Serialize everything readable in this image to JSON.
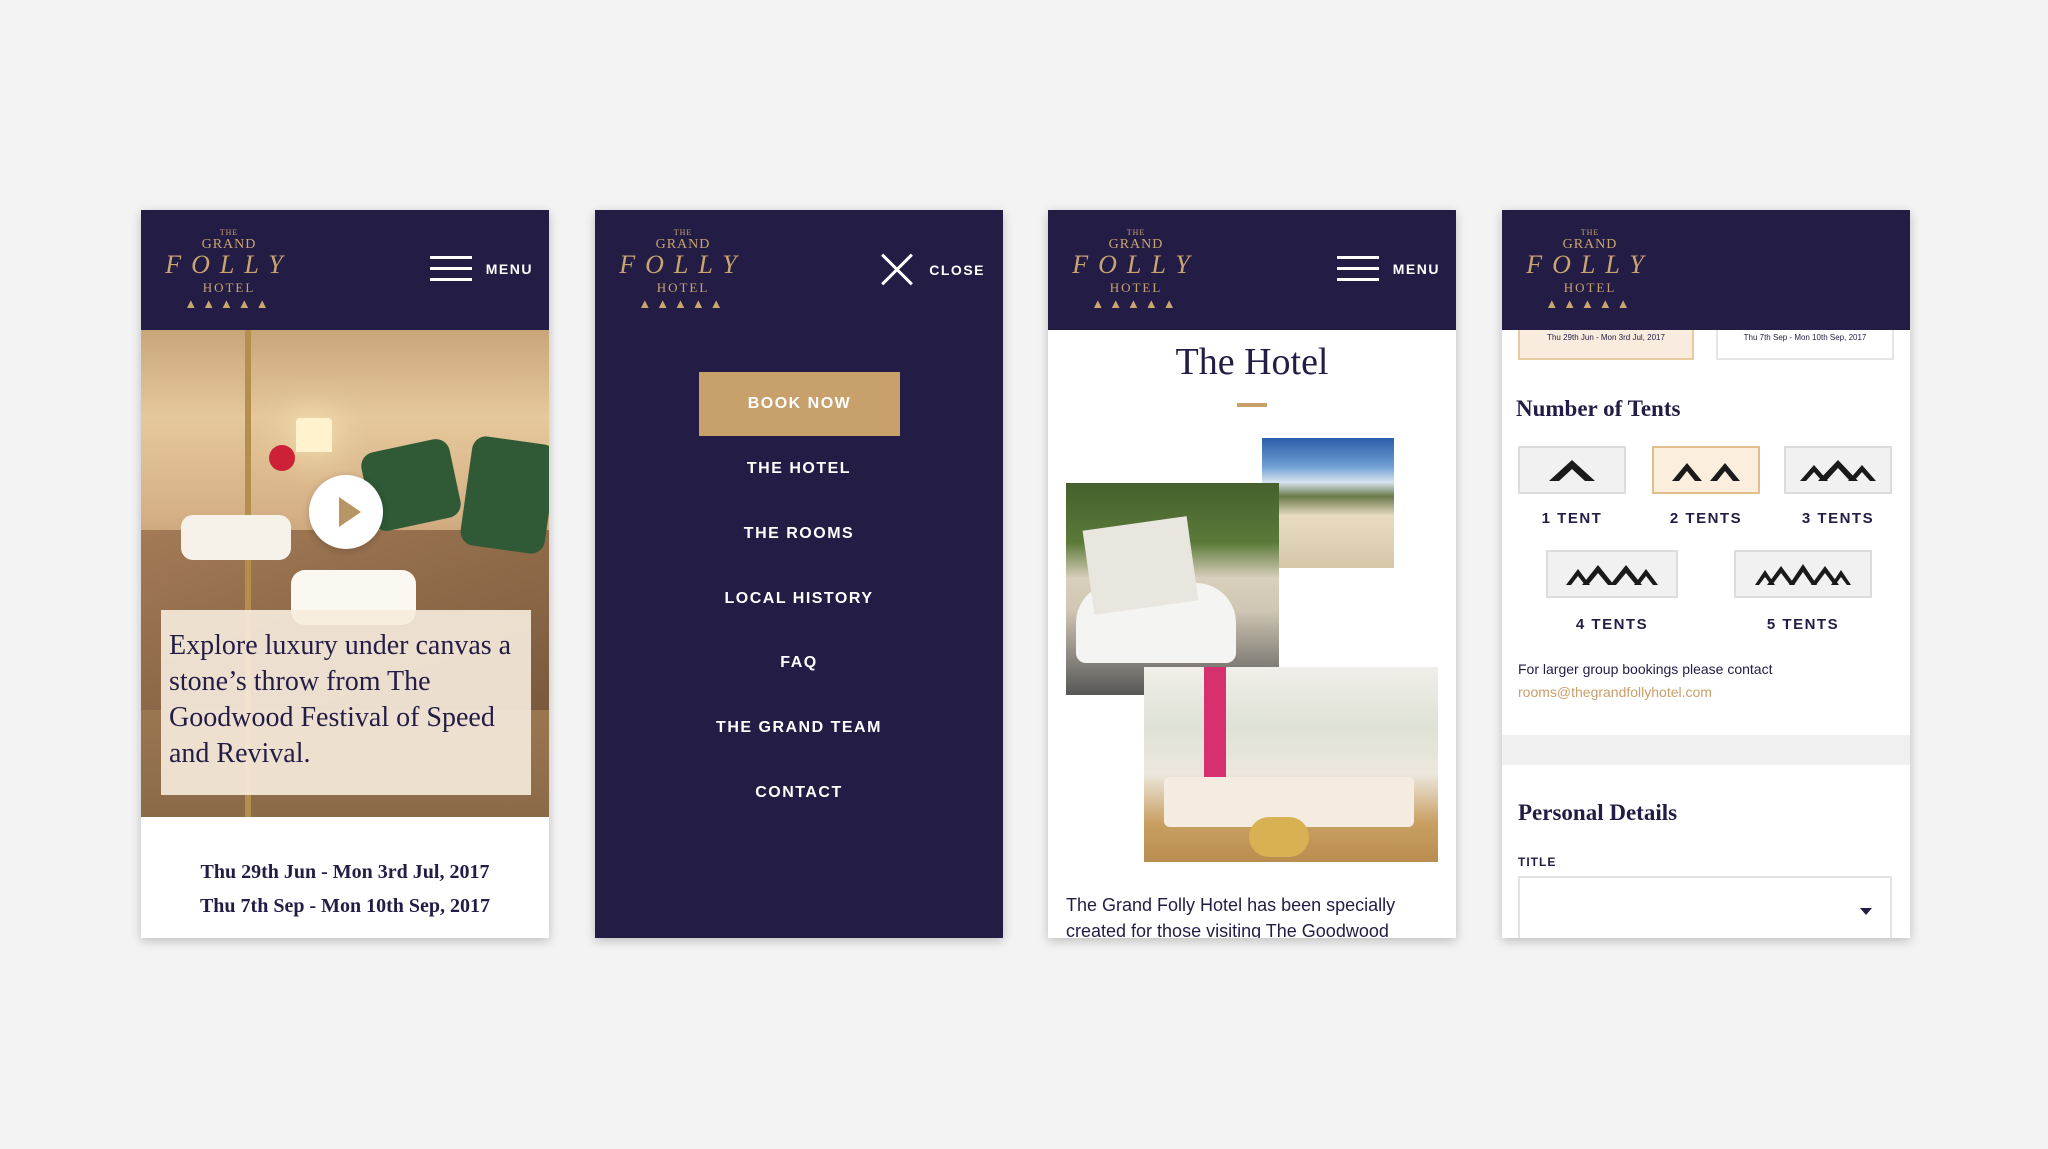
{
  "brand": {
    "logo_the": "THE",
    "logo_grand": "GRAND",
    "logo_folly": "FOLLY",
    "logo_hotel": "HOTEL",
    "logo_tents": "▲▲▲▲▲"
  },
  "screen1": {
    "menu_label": "MENU",
    "hero_caption": "Explore luxury under canvas a stone’s throw from The Goodwood Festival of Speed and Revival.",
    "dates": [
      "Thu 29th Jun - Mon 3rd Jul, 2017",
      "Thu 7th Sep - Mon 10th Sep, 2017"
    ]
  },
  "screen2": {
    "close_label": "CLOSE",
    "book_now": "BOOK NOW",
    "nav_items": [
      "THE HOTEL",
      "THE ROOMS",
      "LOCAL HISTORY",
      "FAQ",
      "THE GRAND TEAM",
      "CONTACT"
    ]
  },
  "screen3": {
    "menu_label": "MENU",
    "title": "The Hotel",
    "body": "The Grand Folly Hotel has been specially created for those visiting The Goodwood"
  },
  "screen4": {
    "date_tabs": [
      "Thu 29th Jun - Mon 3rd Jul, 2017",
      "Thu 7th Sep - Mon 10th Sep, 2017"
    ],
    "tents_heading": "Number of Tents",
    "tent_options": [
      "1 TENT",
      "2 TENTS",
      "3 TENTS",
      "4 TENTS",
      "5 TENTS"
    ],
    "selected_tents": "2 TENTS",
    "note": "For larger group bookings please contact",
    "email": "rooms@thegrandfollyhotel.com",
    "personal_heading": "Personal Details",
    "title_label": "TITLE",
    "title_value": ""
  },
  "colors": {
    "navy": "#231c45",
    "gold": "#c7a06c",
    "background": "#f3f3f3"
  }
}
